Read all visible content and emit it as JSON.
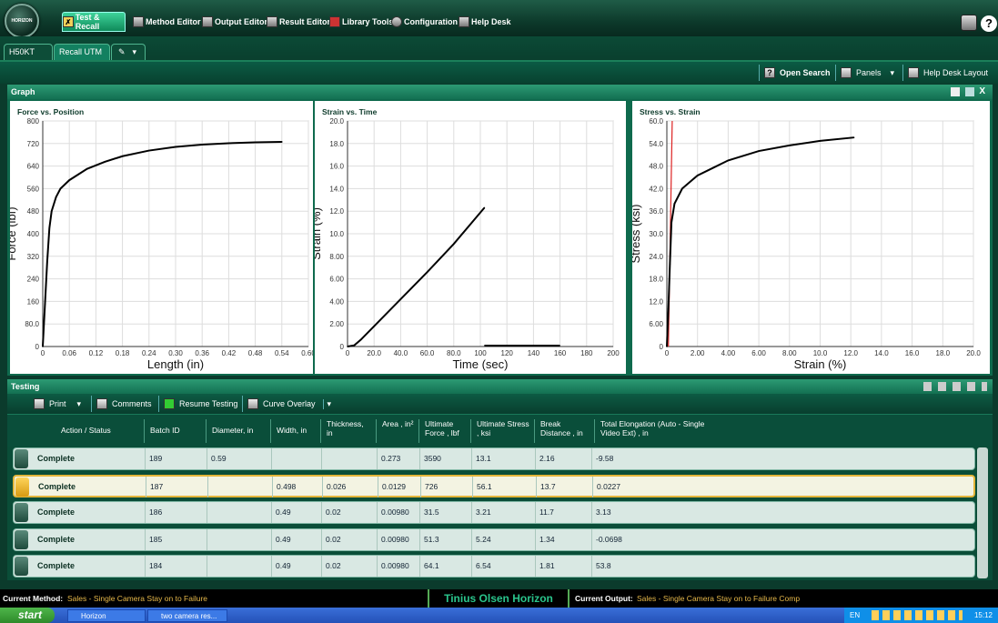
{
  "app": {
    "logo_text": "HORIZON"
  },
  "menu": [
    "Test & Recall",
    "Method Editor",
    "Output Editor",
    "Result Editor",
    "Library Tools",
    "Configuration",
    "Help Desk"
  ],
  "tabs": [
    "H50KT",
    "Recall UTM"
  ],
  "tab_close": "X",
  "toolbar": {
    "search": "Open Search",
    "panels": "Panels",
    "layout": "Help Desk Layout"
  },
  "graph_panel": {
    "title": "Graph",
    "close": "X"
  },
  "chart_data": [
    {
      "type": "line",
      "title": "Force vs. Position",
      "xlabel": "Length (in)",
      "ylabel": "Force (lbf)",
      "xlim": [
        0,
        0.6
      ],
      "ylim": [
        0,
        800
      ],
      "xticks": [
        "0",
        "0.06",
        "0.12",
        "0.18",
        "0.24",
        "0.30",
        "0.36",
        "0.42",
        "0.48",
        "0.54",
        "0.60"
      ],
      "yticks": [
        "0",
        "80.0",
        "160",
        "240",
        "320",
        "400",
        "480",
        "560",
        "640",
        "720",
        "800"
      ],
      "x": [
        0,
        0.005,
        0.01,
        0.015,
        0.02,
        0.03,
        0.04,
        0.06,
        0.08,
        0.1,
        0.14,
        0.18,
        0.24,
        0.3,
        0.36,
        0.42,
        0.48,
        0.54
      ],
      "y": [
        0,
        150,
        300,
        420,
        480,
        530,
        560,
        590,
        610,
        630,
        655,
        675,
        695,
        708,
        716,
        721,
        724,
        726
      ]
    },
    {
      "type": "line",
      "title": "Strain vs. Time",
      "xlabel": "Time (sec)",
      "ylabel": "Strain (%)",
      "xlim": [
        0,
        200
      ],
      "ylim": [
        0,
        20
      ],
      "xticks": [
        "0",
        "20.0",
        "40.0",
        "60.0",
        "80.0",
        "100",
        "120",
        "140",
        "160",
        "180",
        "200"
      ],
      "yticks": [
        "0",
        "2.00",
        "4.00",
        "6.00",
        "8.00",
        "10.0",
        "12.0",
        "14.0",
        "16.0",
        "18.0",
        "20.0"
      ],
      "x": [
        0,
        5,
        10,
        20,
        40,
        60,
        80,
        103
      ],
      "y": [
        0,
        0.1,
        0.6,
        1.8,
        4.2,
        6.6,
        9.1,
        12.3
      ],
      "baseline": [
        [
          103,
          0
        ],
        [
          160,
          0
        ]
      ]
    },
    {
      "type": "line",
      "title": "Stress vs. Strain",
      "xlabel": "Strain (%)",
      "ylabel": "Stress (ksi)",
      "xlim": [
        0,
        20
      ],
      "ylim": [
        0,
        60
      ],
      "xticks": [
        "0",
        "2.00",
        "4.00",
        "6.00",
        "8.00",
        "10.0",
        "12.0",
        "14.0",
        "16.0",
        "18.0",
        "20.0"
      ],
      "yticks": [
        "0",
        "6.00",
        "12.0",
        "18.0",
        "24.0",
        "30.0",
        "36.0",
        "42.0",
        "48.0",
        "54.0",
        "60.0"
      ],
      "x": [
        0,
        0.1,
        0.2,
        0.3,
        0.5,
        1,
        2,
        3,
        4,
        6,
        8,
        10,
        12.2
      ],
      "y": [
        0,
        10,
        22,
        33,
        38,
        42,
        45.5,
        47.5,
        49.5,
        52,
        53.5,
        54.7,
        55.6
      ],
      "red_line": [
        [
          0.1,
          0
        ],
        [
          0.35,
          60
        ]
      ]
    }
  ],
  "testing": {
    "title": "Testing",
    "print": "Print",
    "comments": "Comments",
    "resume": "Resume Testing",
    "overlay": "Curve Overlay",
    "columns": [
      "Action / Status",
      "Batch ID",
      "Diameter, in",
      "Width, in",
      "Thickness, in",
      "Area , in²",
      "Ultimate Force , lbf",
      "Ultimate Stress , ksi",
      "Break Distance , in",
      "Total Elongation (Auto - Single Video Ext) , in"
    ],
    "rows": [
      {
        "status": "Complete",
        "batch": "189",
        "diameter": "0.59",
        "width": "",
        "thickness": "",
        "area": "0.273",
        "force": "3590",
        "stress": "13.1",
        "break": "2.16",
        "elong": "-9.58"
      },
      {
        "status": "Complete",
        "batch": "187",
        "diameter": "",
        "width": "0.498",
        "thickness": "0.026",
        "area": "0.0129",
        "force": "726",
        "stress": "56.1",
        "break": "13.7",
        "elong": "0.0227"
      },
      {
        "status": "Complete",
        "batch": "186",
        "diameter": "",
        "width": "0.49",
        "thickness": "0.02",
        "area": "0.00980",
        "force": "31.5",
        "stress": "3.21",
        "break": "11.7",
        "elong": "3.13"
      },
      {
        "status": "Complete",
        "batch": "185",
        "diameter": "",
        "width": "0.49",
        "thickness": "0.02",
        "area": "0.00980",
        "force": "51.3",
        "stress": "5.24",
        "break": "1.34",
        "elong": "-0.0698"
      },
      {
        "status": "Complete",
        "batch": "184",
        "diameter": "",
        "width": "0.49",
        "thickness": "0.02",
        "area": "0.00980",
        "force": "64.1",
        "stress": "6.54",
        "break": "1.81",
        "elong": "53.8"
      }
    ]
  },
  "status": {
    "method_label": "Current Method:",
    "method_value": "Sales - Single Camera Stay on to Failure",
    "brand": "Tinius Olsen Horizon",
    "output_label": "Current Output:",
    "output_value": "Sales - Single Camera Stay on to Failure Comp"
  },
  "taskbar": {
    "start": "start",
    "items": [
      "Horizon",
      "two camera res..."
    ],
    "lang": "EN",
    "clock": "15:12"
  },
  "colors": {
    "accent": "#12a070",
    "selected": "#e3b53a",
    "status_text": "#e6b84a"
  }
}
